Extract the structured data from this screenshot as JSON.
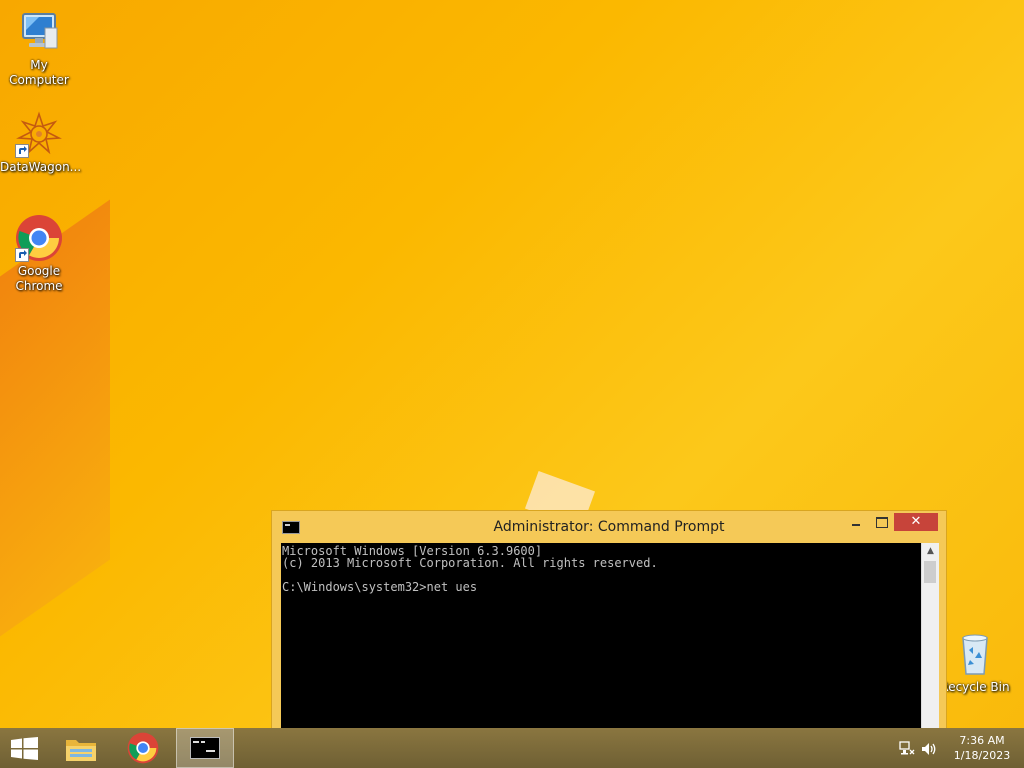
{
  "desktop": {
    "icons": [
      {
        "label": "My Computer",
        "icon": "computer-icon"
      },
      {
        "label": "DataWagon...",
        "icon": "datawagon-icon"
      },
      {
        "label": "Google\nChrome",
        "icon": "chrome-icon"
      },
      {
        "label": "Recycle Bin",
        "icon": "recycle-bin-icon"
      }
    ]
  },
  "cmd": {
    "title": "Administrator:  Command Prompt",
    "close_glyph": "✕",
    "scroll_up_glyph": "▲",
    "lines": [
      "Microsoft Windows [Version 6.3.9600]",
      "(c) 2013 Microsoft Corporation. All rights reserved.",
      "",
      "C:\\Windows\\system32>net ues"
    ]
  },
  "taskbar": {
    "items": [
      {
        "name": "start-button",
        "icon": "windows-logo-icon"
      },
      {
        "name": "file-explorer",
        "icon": "folder-icon"
      },
      {
        "name": "chrome",
        "icon": "chrome-icon"
      },
      {
        "name": "command-prompt",
        "icon": "cmd-icon",
        "active": true
      }
    ],
    "tray": {
      "icons": [
        "network-icon",
        "volume-icon"
      ],
      "time": "7:36 AM",
      "date": "1/18/2023"
    }
  },
  "colors": {
    "wallpaper": "#fbb800",
    "window_frame": "#f5c957",
    "close_button": "#c7443a",
    "taskbar": "#7a6a3c",
    "console_bg": "#000000",
    "console_text": "#c0c0c0"
  }
}
